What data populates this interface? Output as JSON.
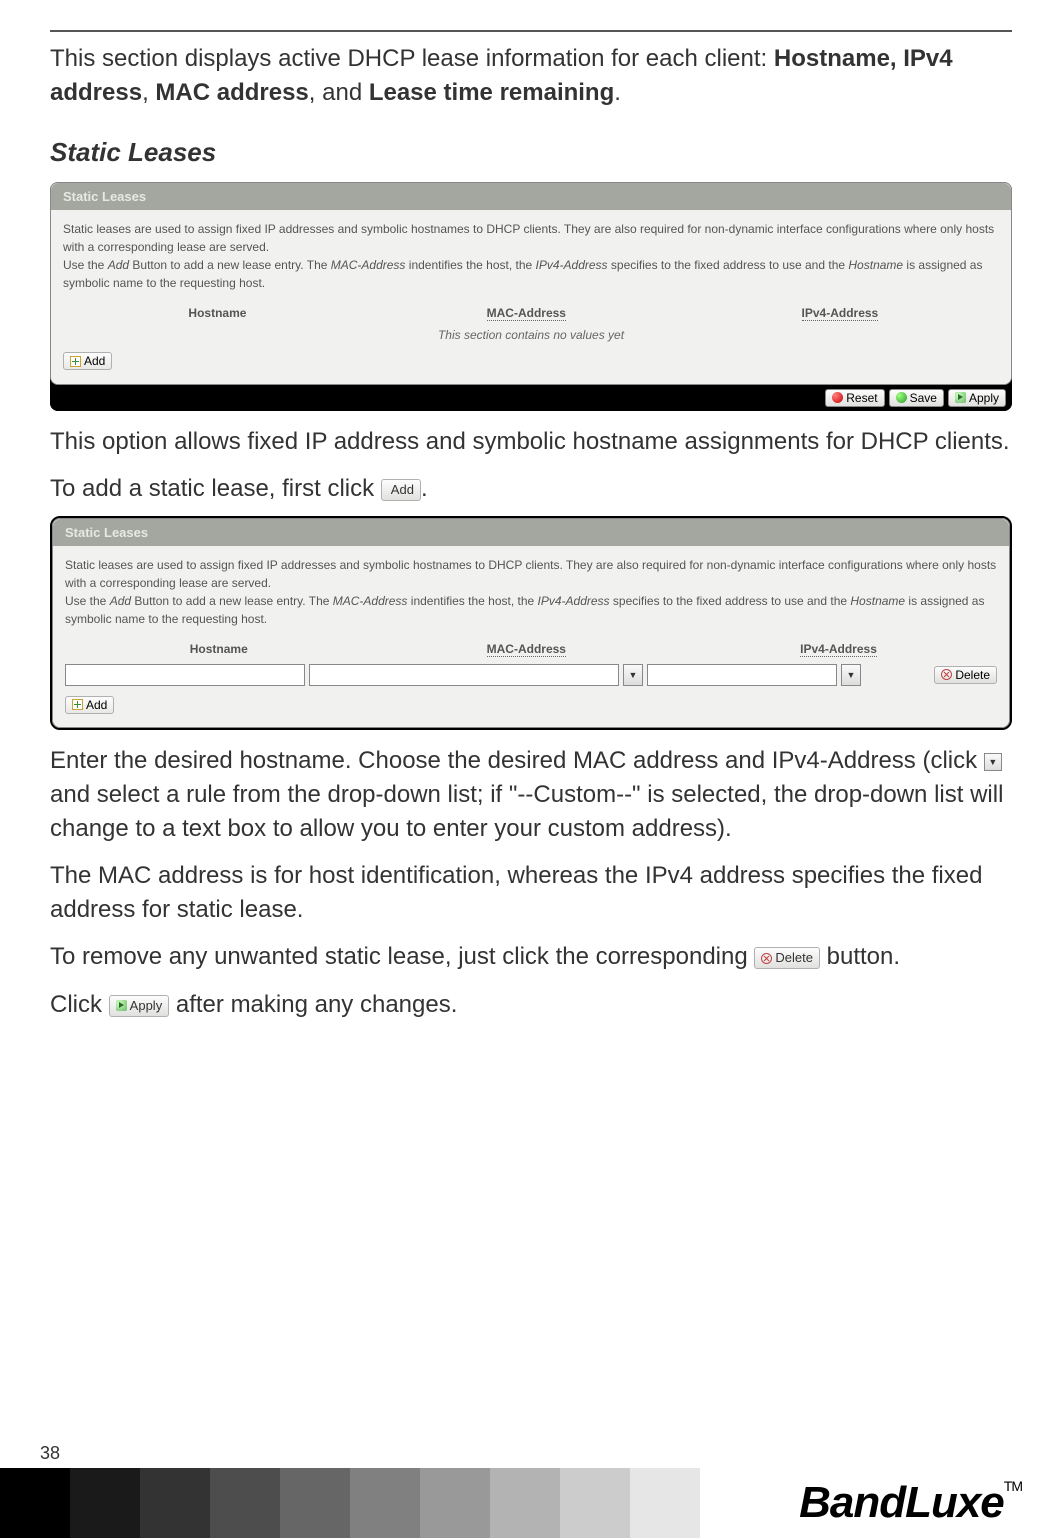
{
  "intro": {
    "line1": "This section displays active DHCP lease information for each client: ",
    "bold1": "Hostname, IPv4 address",
    "sep1": ", ",
    "bold2": "MAC address",
    "sep2": ", and ",
    "bold3": "Lease time remaining",
    "end": "."
  },
  "section_title": "Static Leases",
  "panel1": {
    "header": "Static Leases",
    "desc_pre": "Static leases are used to assign fixed IP addresses and symbolic hostnames to DHCP clients. They are also required for non-dynamic interface configurations where only hosts with a corresponding lease are served.",
    "desc_line2_a": "Use the ",
    "desc_line2_add": "Add",
    "desc_line2_b": " Button to add a new lease entry. The ",
    "desc_line2_mac": "MAC-Address",
    "desc_line2_c": " indentifies the host, the ",
    "desc_line2_ipv4": "IPv4-Address",
    "desc_line2_d": " specifies to the fixed address to use and the ",
    "desc_line2_host": "Hostname",
    "desc_line2_e": " is assigned as symbolic name to the requesting host.",
    "th_hostname": "Hostname",
    "th_mac": "MAC-Address",
    "th_ipv4": "IPv4-Address",
    "no_values": "This section contains no values yet",
    "add_label": "Add",
    "reset_label": "Reset",
    "save_label": "Save",
    "apply_label": "Apply"
  },
  "desc_after_panel1": "This option allows fixed IP address and symbolic hostname assignments for DHCP clients.",
  "add_lease_text_a": "To add a static lease, first click ",
  "add_lease_text_b": ".",
  "panel2": {
    "header": "Static Leases",
    "desc_pre": "Static leases are used to assign fixed IP addresses and symbolic hostnames to DHCP clients. They are also required for non-dynamic interface configurations where only hosts with a corresponding lease are served.",
    "desc_line2_a": "Use the ",
    "desc_line2_add": "Add",
    "desc_line2_b": " Button to add a new lease entry. The ",
    "desc_line2_mac": "MAC-Address",
    "desc_line2_c": " indentifies the host, the ",
    "desc_line2_ipv4": "IPv4-Address",
    "desc_line2_d": " specifies to the fixed address to use and the ",
    "desc_line2_host": "Hostname",
    "desc_line2_e": " is assigned as symbolic name to the requesting host.",
    "th_hostname": "Hostname",
    "th_mac": "MAC-Address",
    "th_ipv4": "IPv4-Address",
    "delete_label": "Delete",
    "add_label": "Add"
  },
  "para3": "Enter the desired hostname. Choose the desired MAC address and IPv4-Address (click ",
  "para3b": " and select a rule from the drop-down list; if \"--Custom--\" is selected, the drop-down list will change to a text box to allow you to enter your custom address).",
  "para4": "The MAC address is for host identification, whereas the IPv4 address specifies the fixed address for static lease.",
  "para5a": "To remove any unwanted static lease, just click the corresponding ",
  "para5b": " button.",
  "para6a": "Click ",
  "para6b": " after making any changes.",
  "inline_add": "Add",
  "inline_delete": "Delete",
  "inline_apply": "Apply",
  "page_number": "38",
  "logo_text": "BandLuxe",
  "logo_tm": "TM",
  "gray_squares": [
    "#000000",
    "#1a1a1a",
    "#333333",
    "#4d4d4d",
    "#666666",
    "#808080",
    "#999999",
    "#b3b3b3",
    "#cccccc",
    "#e6e6e6"
  ]
}
